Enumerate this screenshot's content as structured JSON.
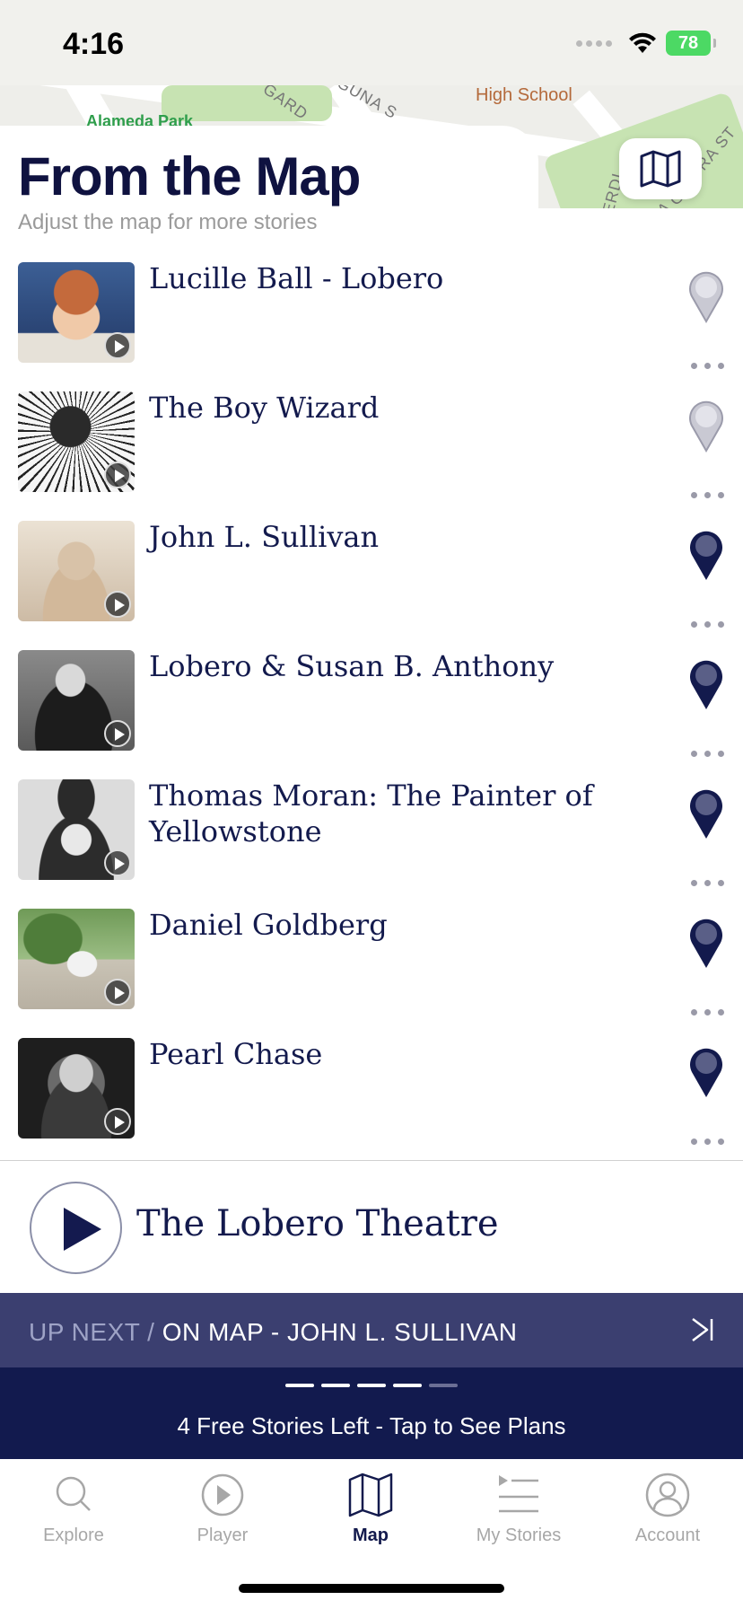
{
  "status": {
    "time": "4:16",
    "battery": "78"
  },
  "map_labels": {
    "park": "Alameda Park",
    "school": "High School",
    "street1": "GARD",
    "street2": "GUNA S",
    "street3": "ERDI",
    "street4": "LA GU",
    "street5": "RA ST"
  },
  "header": {
    "title": "From the Map",
    "subtitle": "Adjust the map for more stories"
  },
  "stories": [
    {
      "title": "Lucille Ball - Lobero",
      "pin": "inactive"
    },
    {
      "title": "The Boy Wizard",
      "pin": "inactive"
    },
    {
      "title": "John L. Sullivan",
      "pin": "active"
    },
    {
      "title": "Lobero & Susan B. Anthony",
      "pin": "active"
    },
    {
      "title": "Thomas Moran: The Painter of Yellowstone",
      "pin": "active"
    },
    {
      "title": "Daniel Goldberg",
      "pin": "active"
    },
    {
      "title": "Pearl Chase",
      "pin": "active"
    }
  ],
  "now_playing": {
    "title": "The Lobero Theatre"
  },
  "up_next": {
    "prefix": "UP NEXT /",
    "value": "ON MAP - JOHN L. SULLIVAN"
  },
  "plans": {
    "text": "4 Free Stories Left - Tap to See Plans",
    "segments_filled": 4,
    "segments_total": 5
  },
  "tabs": [
    {
      "label": "Explore",
      "icon": "search-icon"
    },
    {
      "label": "Player",
      "icon": "play-circle-icon"
    },
    {
      "label": "Map",
      "icon": "map-icon",
      "active": true
    },
    {
      "label": "My Stories",
      "icon": "list-icon"
    },
    {
      "label": "Account",
      "icon": "account-icon"
    }
  ],
  "colors": {
    "navy": "#131a4d",
    "up_next_bg": "#3b3f70",
    "plans_bg": "#121a4e",
    "pin_active": "#5a5f87",
    "pin_inactive": "#c9c9d3"
  }
}
